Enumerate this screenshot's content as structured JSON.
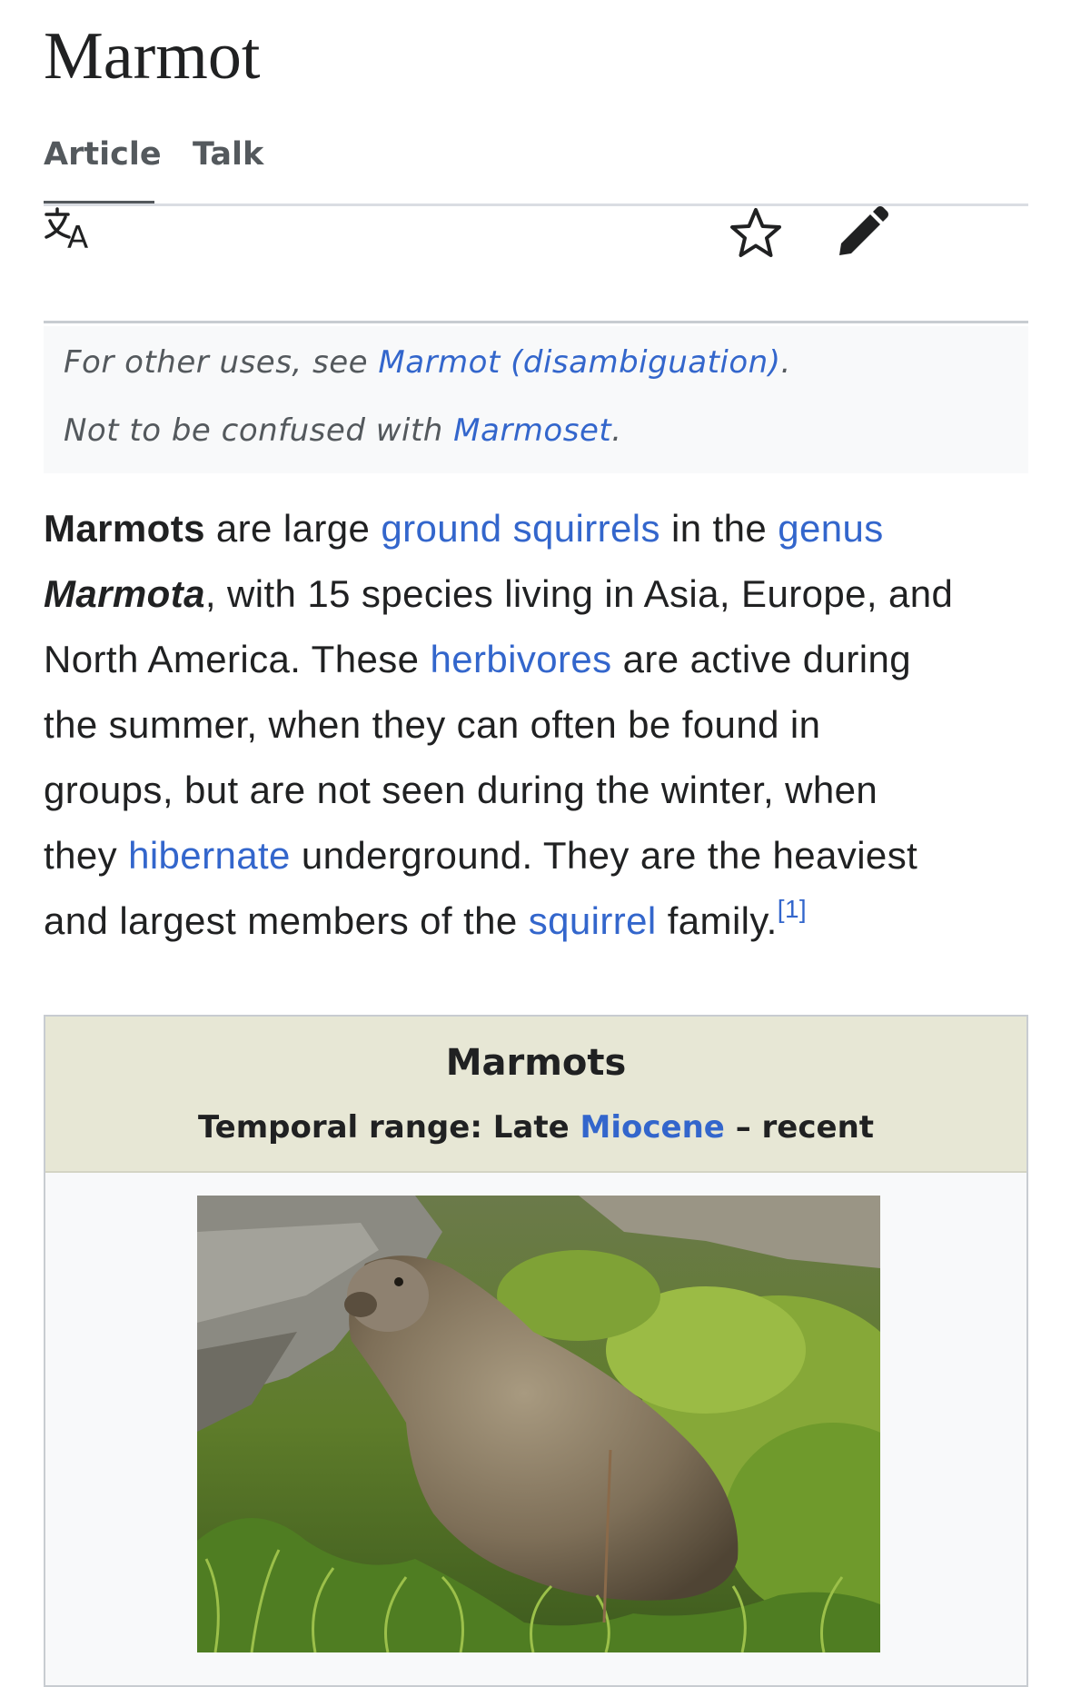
{
  "article": {
    "title": "Marmot"
  },
  "tabs": [
    {
      "label": "Article",
      "active": true
    },
    {
      "label": "Talk",
      "active": false
    }
  ],
  "toolbar": {
    "language_icon": "translate-icon",
    "watch_icon": "star-icon",
    "edit_icon": "pencil-icon"
  },
  "hatnotes": [
    {
      "prefix": "For other uses, see ",
      "link": "Marmot (disambiguation)",
      "suffix": "."
    },
    {
      "prefix": "Not to be confused with ",
      "link": "Marmoset",
      "suffix": "."
    }
  ],
  "lead": {
    "bold_term": "Marmots",
    "t1": " are large ",
    "link_ground_squirrels": "ground squirrels",
    "t2": " in the ",
    "link_genus": "genus",
    "genus_name": "Marmota",
    "t3": ", with 15 species living in Asia, Europe, and",
    "t4": "North America. These ",
    "link_herbivores": "herbivores",
    "t5": " are active during",
    "t6": "the summer, when they can often be found in",
    "t7": "groups, but are not seen during the winter, when",
    "t8": "they ",
    "link_hibernate": "hibernate",
    "t9": " underground. They are the heaviest",
    "t10": "and largest members of the ",
    "link_squirrel": "squirrel",
    "t11": " family.",
    "ref": "[1]"
  },
  "infobox": {
    "title": "Marmots",
    "range_prefix": "Temporal range: Late ",
    "range_link": "Miocene",
    "range_suffix": " – recent",
    "image_subject": "marmot photo"
  },
  "colors": {
    "link": "#3366cc",
    "text": "#202122",
    "infobox_header": "#e7e7d5",
    "hatnote_bg": "#f8f9fa"
  }
}
